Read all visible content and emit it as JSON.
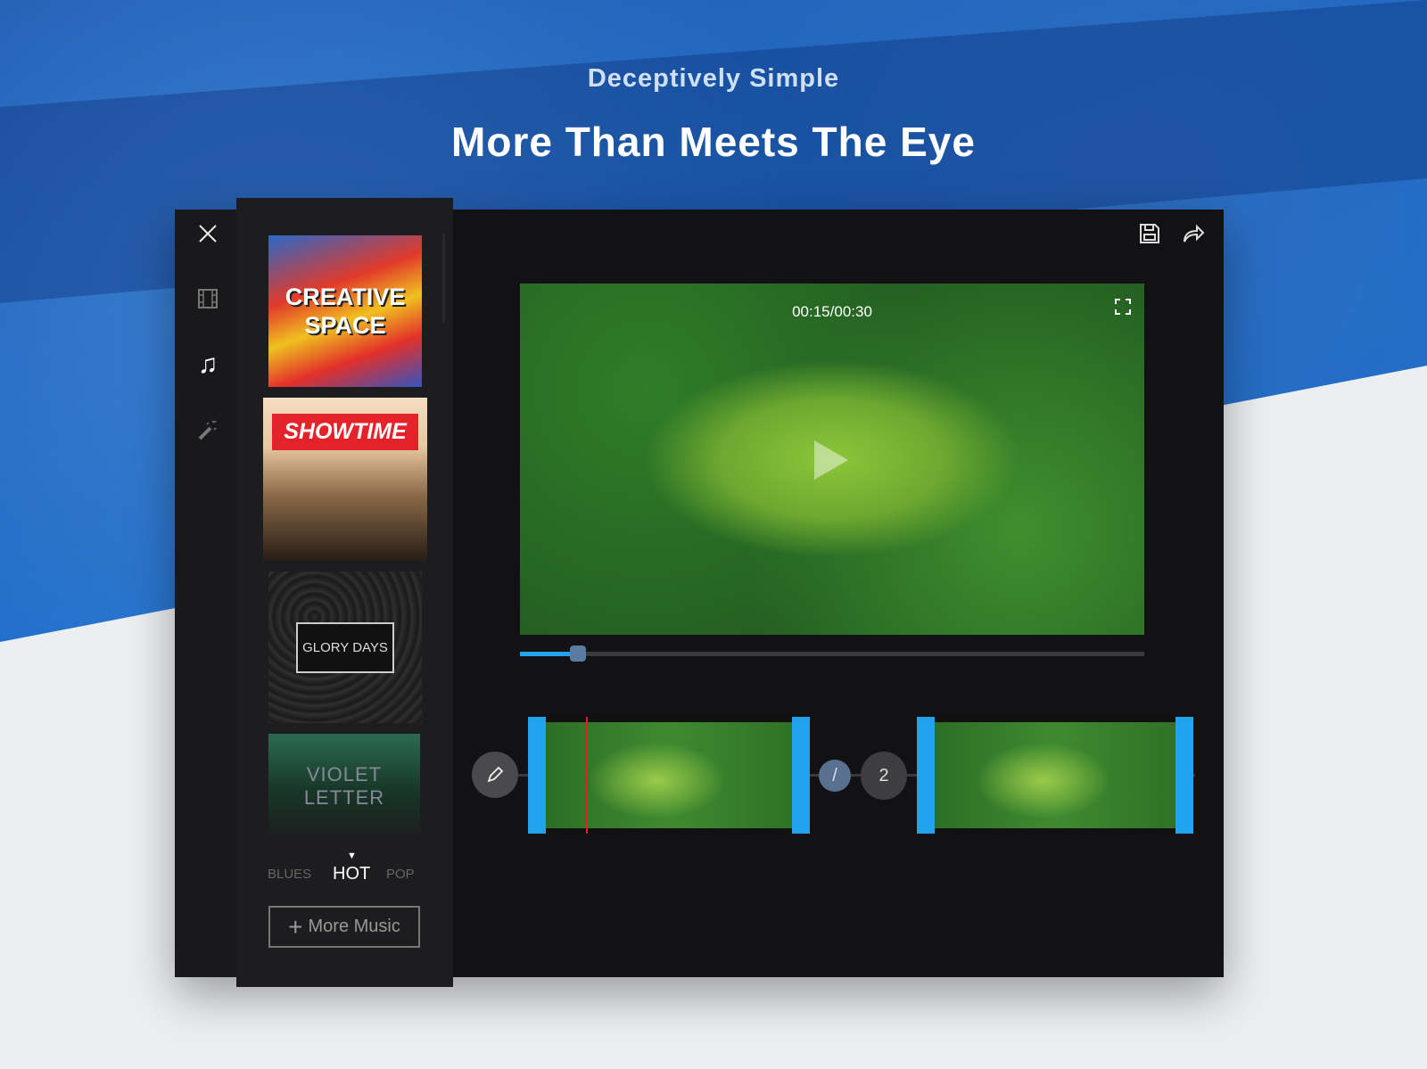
{
  "header": {
    "subtitle": "Deceptively Simple",
    "title": "More Than Meets The Eye"
  },
  "sidebar": {
    "icons": [
      "close-icon",
      "film-icon",
      "music-note-icon",
      "magic-wand-icon"
    ],
    "active": "music-note-icon"
  },
  "music": {
    "cards": [
      {
        "title_line1": "CREATIVE",
        "title_line2": "SPACE"
      },
      {
        "title": "SHOWTIME"
      },
      {
        "title": "GLORY DAYS"
      },
      {
        "title_line1": "VIOLET",
        "title_line2": "LETTER"
      }
    ],
    "tabs": [
      {
        "label": "BLUES"
      },
      {
        "label": "HOT",
        "active": true
      },
      {
        "label": "POP"
      }
    ],
    "more_button": "More Music"
  },
  "toolbar": {
    "icons": [
      "save-icon",
      "share-icon"
    ]
  },
  "player": {
    "time": "00:15/00:30",
    "progress": 0.093,
    "accent": "#22a3f0"
  },
  "timeline": {
    "transition_number": "2",
    "clips": 2
  }
}
